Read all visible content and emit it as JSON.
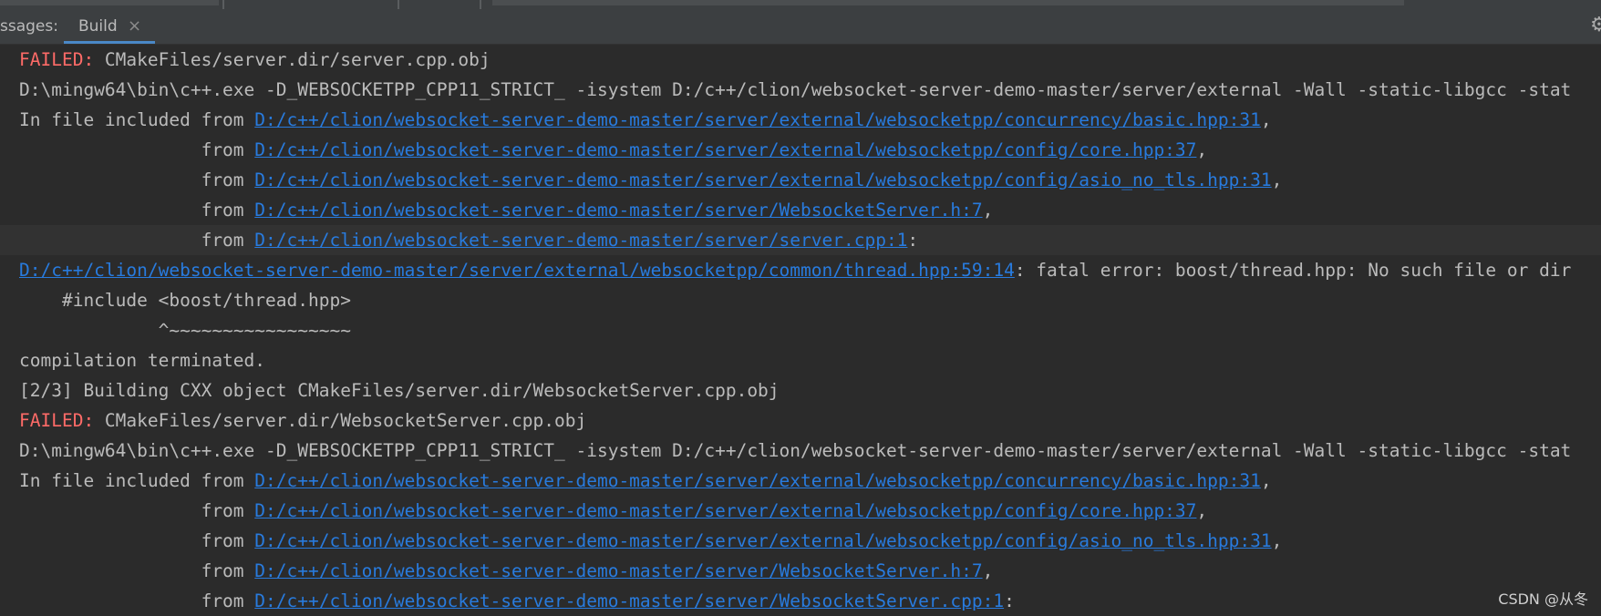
{
  "toolbar": {
    "panel_label": "ssages:",
    "tab_label": "Build",
    "tab_close": "×",
    "gear": "⚙"
  },
  "console": {
    "lines": [
      {
        "failed": "FAILED:",
        "pre": " CMakeFiles/server.dir/server.cpp.obj",
        "link": "",
        "post": ""
      },
      {
        "failed": "",
        "pre": "D:\\mingw64\\bin\\c++.exe -D_WEBSOCKETPP_CPP11_STRICT_ -isystem D:/c++/clion/websocket-server-demo-master/server/external -Wall -static-libgcc -stat",
        "link": "",
        "post": ""
      },
      {
        "failed": "",
        "pre": "In file included from ",
        "link": "D:/c++/clion/websocket-server-demo-master/server/external/websocketpp/concurrency/basic.hpp:31",
        "post": ","
      },
      {
        "failed": "",
        "pre": "                 from ",
        "link": "D:/c++/clion/websocket-server-demo-master/server/external/websocketpp/config/core.hpp:37",
        "post": ","
      },
      {
        "failed": "",
        "pre": "                 from ",
        "link": "D:/c++/clion/websocket-server-demo-master/server/external/websocketpp/config/asio_no_tls.hpp:31",
        "post": ","
      },
      {
        "failed": "",
        "pre": "                 from ",
        "link": "D:/c++/clion/websocket-server-demo-master/server/WebsocketServer.h:7",
        "post": ","
      },
      {
        "failed": "",
        "pre": "                 from ",
        "link": "D:/c++/clion/websocket-server-demo-master/server/server.cpp:1",
        "post": ":"
      },
      {
        "failed": "",
        "pre": "",
        "link": "D:/c++/clion/websocket-server-demo-master/server/external/websocketpp/common/thread.hpp:59:14",
        "post": ": fatal error: boost/thread.hpp: No such file or dir"
      },
      {
        "failed": "",
        "pre": "    #include <boost/thread.hpp>",
        "link": "",
        "post": ""
      },
      {
        "failed": "",
        "pre": "             ^~~~~~~~~~~~~~~~~~",
        "link": "",
        "post": ""
      },
      {
        "failed": "",
        "pre": "compilation terminated.",
        "link": "",
        "post": ""
      },
      {
        "failed": "",
        "pre": "[2/3] Building CXX object CMakeFiles/server.dir/WebsocketServer.cpp.obj",
        "link": "",
        "post": ""
      },
      {
        "failed": "FAILED:",
        "pre": " CMakeFiles/server.dir/WebsocketServer.cpp.obj",
        "link": "",
        "post": ""
      },
      {
        "failed": "",
        "pre": "D:\\mingw64\\bin\\c++.exe -D_WEBSOCKETPP_CPP11_STRICT_ -isystem D:/c++/clion/websocket-server-demo-master/server/external -Wall -static-libgcc -stat",
        "link": "",
        "post": ""
      },
      {
        "failed": "",
        "pre": "In file included from ",
        "link": "D:/c++/clion/websocket-server-demo-master/server/external/websocketpp/concurrency/basic.hpp:31",
        "post": ","
      },
      {
        "failed": "",
        "pre": "                 from ",
        "link": "D:/c++/clion/websocket-server-demo-master/server/external/websocketpp/config/core.hpp:37",
        "post": ","
      },
      {
        "failed": "",
        "pre": "                 from ",
        "link": "D:/c++/clion/websocket-server-demo-master/server/external/websocketpp/config/asio_no_tls.hpp:31",
        "post": ","
      },
      {
        "failed": "",
        "pre": "                 from ",
        "link": "D:/c++/clion/websocket-server-demo-master/server/WebsocketServer.h:7",
        "post": ","
      },
      {
        "failed": "",
        "pre": "                 from ",
        "link": "D:/c++/clion/websocket-server-demo-master/server/WebsocketServer.cpp:1",
        "post": ":"
      }
    ]
  },
  "watermark": "CSDN @从冬",
  "colors": {
    "background": "#2b2b2b",
    "toolbar": "#3c3f41",
    "failed": "#ff6b68",
    "link": "#287bde",
    "text": "#bbbbbb",
    "tab_underline": "#4a88c7"
  }
}
